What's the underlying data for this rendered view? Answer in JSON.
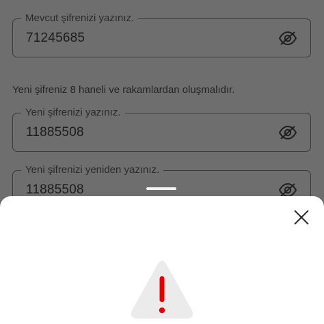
{
  "form": {
    "current_password": {
      "label": "Mevcut şifrenizi yazınız.",
      "value": "71245685",
      "visibility_icon": "eye-off-icon"
    },
    "hint": "Yeni şifreniz 8 haneli ve rakamlardan oluşmalıdır.",
    "new_password": {
      "label": "Yeni şifrenizi yazınız.",
      "value": "11885508",
      "visibility_icon": "eye-off-icon"
    },
    "confirm_password": {
      "label": "Yeni şifrenizi yeniden yazınız.",
      "value": "11885508",
      "visibility_icon": "eye-off-icon"
    }
  },
  "bottom_sheet": {
    "close_icon": "close-icon",
    "status_icon": "warning-triangle-icon",
    "colors": {
      "warning_accent": "#e60000",
      "triangle_fill": "#ebebeb"
    }
  },
  "colors": {
    "overlay_background": "#6e6e6e",
    "sheet_background": "#ffffff"
  }
}
